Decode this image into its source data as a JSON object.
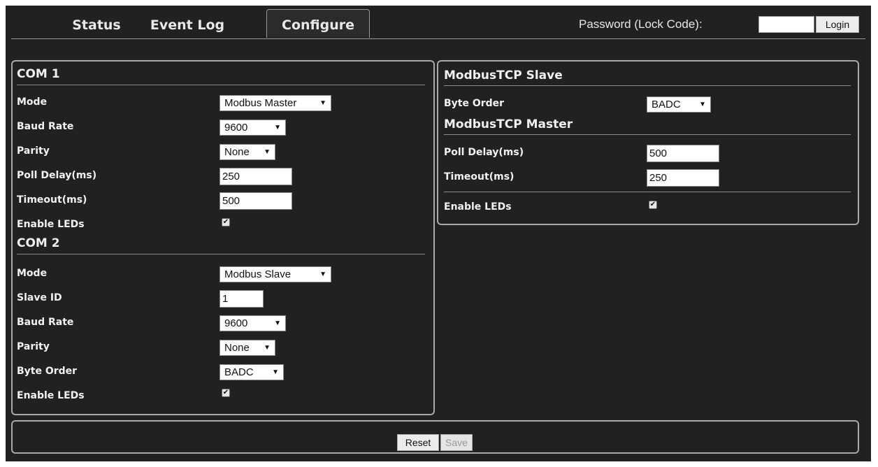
{
  "tabs": [
    {
      "label": "Status"
    },
    {
      "label": "Event Log"
    },
    {
      "label": "Configure"
    }
  ],
  "login": {
    "password_label": "Password (Lock Code):",
    "password_value": "",
    "login_label": "Login"
  },
  "com1": {
    "title": "COM 1",
    "mode": {
      "label": "Mode",
      "value": "Modbus Master"
    },
    "baud": {
      "label": "Baud Rate",
      "value": "9600"
    },
    "parity": {
      "label": "Parity",
      "value": "None"
    },
    "poll": {
      "label": "Poll Delay(ms)",
      "value": "250"
    },
    "timeout": {
      "label": "Timeout(ms)",
      "value": "500"
    },
    "leds": {
      "label": "Enable LEDs",
      "checked": true
    }
  },
  "com2": {
    "title": "COM 2",
    "mode": {
      "label": "Mode",
      "value": "Modbus Slave"
    },
    "slave_id": {
      "label": "Slave ID",
      "value": "1"
    },
    "baud": {
      "label": "Baud Rate",
      "value": "9600"
    },
    "parity": {
      "label": "Parity",
      "value": "None"
    },
    "byte_order": {
      "label": "Byte Order",
      "value": "BADC"
    },
    "leds": {
      "label": "Enable LEDs",
      "checked": true
    }
  },
  "tcp_slave": {
    "title": "ModbusTCP Slave",
    "byte_order": {
      "label": "Byte Order",
      "value": "BADC"
    }
  },
  "tcp_master": {
    "title": "ModbusTCP Master",
    "poll": {
      "label": "Poll Delay(ms)",
      "value": "500"
    },
    "timeout": {
      "label": "Timeout(ms)",
      "value": "250"
    },
    "leds": {
      "label": "Enable LEDs",
      "checked": true
    }
  },
  "actions": {
    "reset_label": "Reset",
    "save_label": "Save"
  },
  "icons": {
    "dropdown": "dropdown-arrow-icon",
    "checkbox": "checkmark-icon"
  },
  "colors": {
    "background": "#212121",
    "border": "#a9a9a9",
    "text": "#f2f2f2"
  }
}
